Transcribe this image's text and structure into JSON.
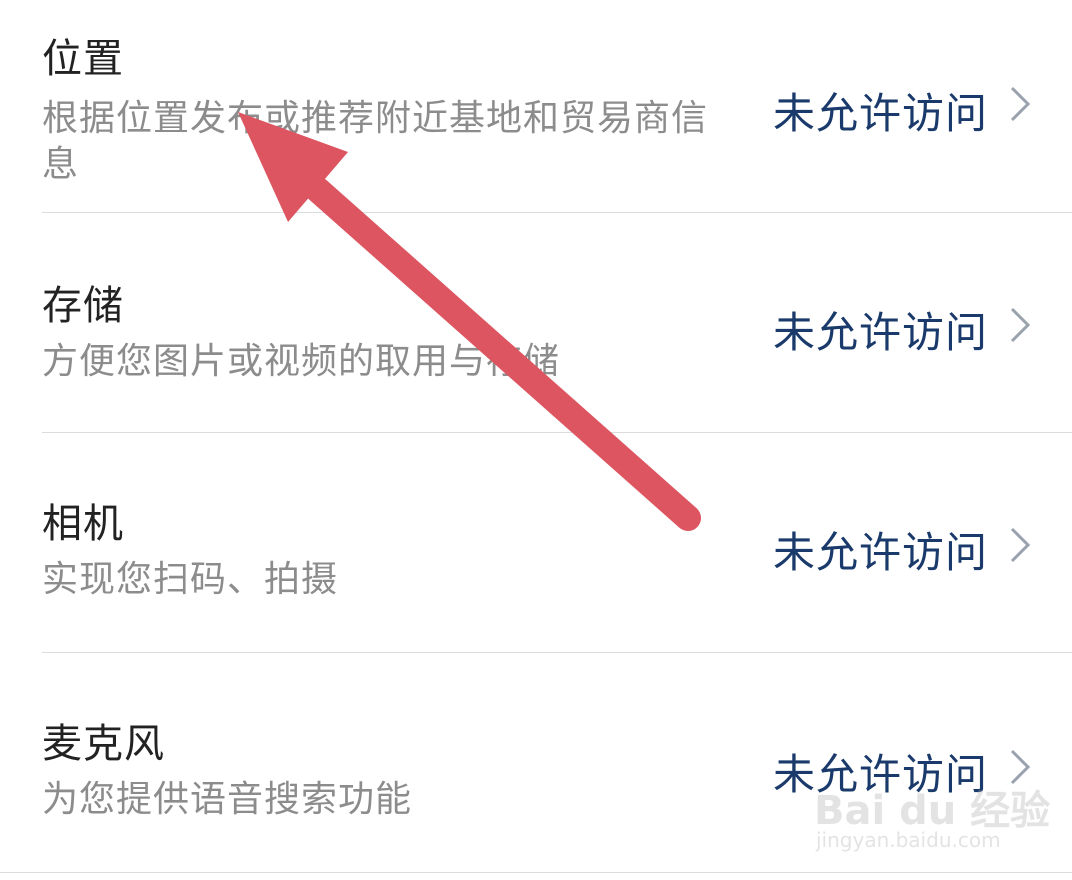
{
  "permissions": [
    {
      "title": "位置",
      "desc": "根据位置发布或推荐附近基地和贸易商信息",
      "status": "未允许访问"
    },
    {
      "title": "存储",
      "desc": "方便您图片或视频的取用与存储",
      "status": "未允许访问"
    },
    {
      "title": "相机",
      "desc": "实现您扫码、拍摄",
      "status": "未允许访问"
    },
    {
      "title": "麦克风",
      "desc": "为您提供语音搜索功能",
      "status": "未允许访问"
    }
  ],
  "watermark": {
    "brand": "Bai du 经验",
    "url": "jingyan.baidu.com"
  },
  "colors": {
    "status": "#1a3a6b",
    "arrow": "#dc5560",
    "title": "#222222",
    "desc": "#8c8c8c"
  },
  "icons": {
    "chevron": "chevron-right-icon",
    "annotation": "red-arrow-annotation"
  }
}
